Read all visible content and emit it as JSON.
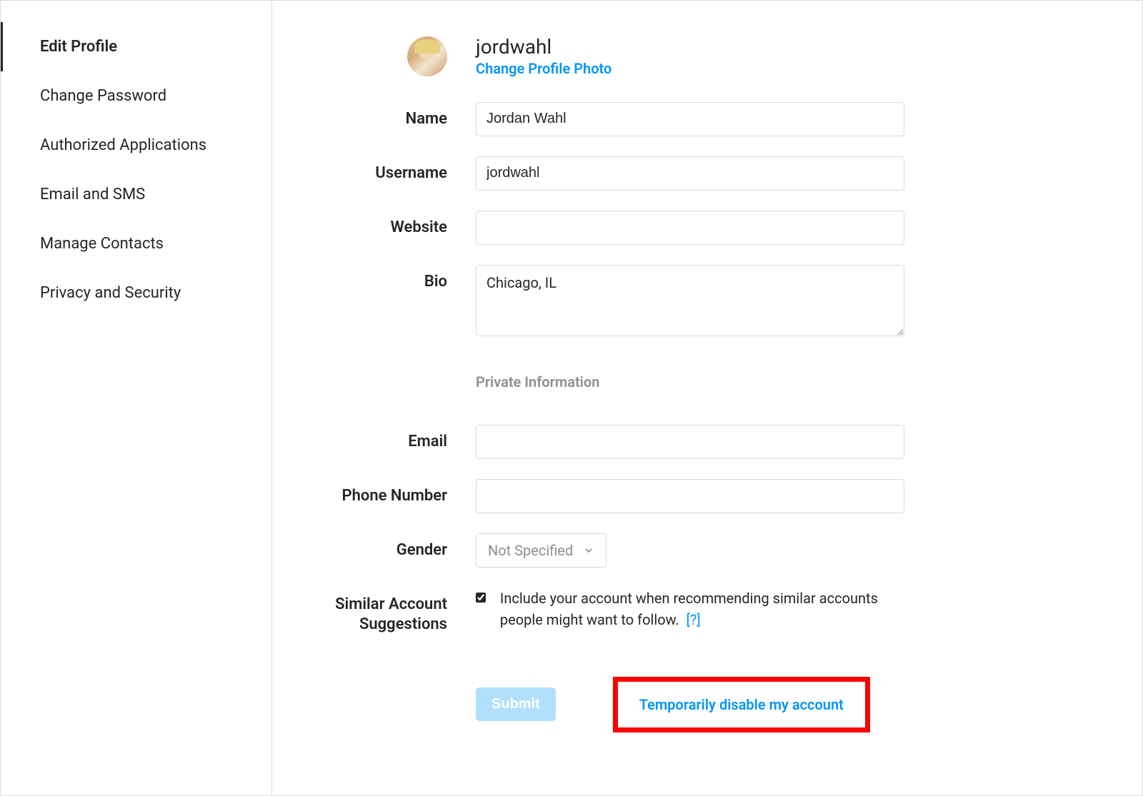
{
  "colors": {
    "accent": "#0095f6",
    "border": "#dbdbdb",
    "muted": "#8e8e8e",
    "highlight_box": "#ff0000"
  },
  "sidebar": {
    "items": [
      {
        "label": "Edit Profile",
        "active": true
      },
      {
        "label": "Change Password",
        "active": false
      },
      {
        "label": "Authorized Applications",
        "active": false
      },
      {
        "label": "Email and SMS",
        "active": false
      },
      {
        "label": "Manage Contacts",
        "active": false
      },
      {
        "label": "Privacy and Security",
        "active": false
      }
    ]
  },
  "profile": {
    "username_display": "jordwahl",
    "change_photo_label": "Change Profile Photo"
  },
  "form": {
    "name": {
      "label": "Name",
      "value": "Jordan Wahl"
    },
    "username": {
      "label": "Username",
      "value": "jordwahl"
    },
    "website": {
      "label": "Website",
      "value": ""
    },
    "bio": {
      "label": "Bio",
      "value": "Chicago, IL"
    },
    "private_section_label": "Private Information",
    "email": {
      "label": "Email",
      "value": ""
    },
    "phone": {
      "label": "Phone Number",
      "value": ""
    },
    "gender": {
      "label": "Gender",
      "value": "Not Specified"
    },
    "similar": {
      "label": "Similar Account Suggestions",
      "checked": true,
      "text": "Include your account when recommending similar accounts people might want to follow.",
      "help": "[?]"
    }
  },
  "actions": {
    "submit_label": "Submit",
    "disable_label": "Temporarily disable my account"
  }
}
